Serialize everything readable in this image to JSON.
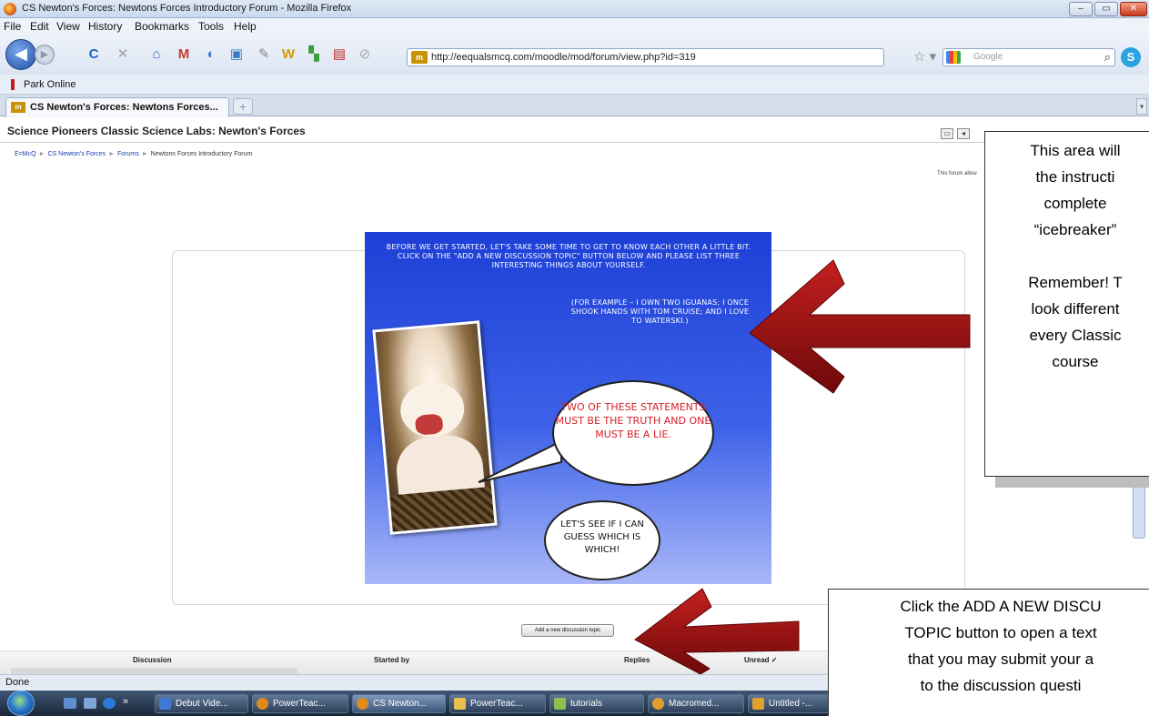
{
  "window": {
    "title": "CS Newton's Forces: Newtons Forces Introductory Forum - Mozilla Firefox",
    "min": "–",
    "max": "▭",
    "close": "✕"
  },
  "menu": [
    "File",
    "Edit",
    "View",
    "History",
    "Bookmarks",
    "Tools",
    "Help"
  ],
  "nav": {
    "url": "http://eequalsmcq.com/moodle/mod/forum/view.php?id=319",
    "search_placeholder": "Google",
    "favicon_text": "m"
  },
  "bookmarks": [
    "Park Online"
  ],
  "tabs": [
    {
      "label": "CS Newton's Forces: Newtons Forces..."
    }
  ],
  "page": {
    "site_title": "Science Pioneers Classic Science Labs: Newton's Forces",
    "breadcrumb": [
      "E=McQ",
      "CS Newton's Forces",
      "Forums",
      "Newtons Forces Introductory Forum"
    ],
    "forum_note": "This forum allow",
    "poster": {
      "intro": "BEFORE WE GET STARTED, LET'S TAKE SOME TIME TO GET TO KNOW EACH OTHER A LITTLE BIT. CLICK ON THE \"ADD A NEW DISCUSSION TOPIC\" BUTTON BELOW AND PLEASE LIST THREE INTERESTING THINGS ABOUT YOURSELF.",
      "example": "(FOR EXAMPLE – I OWN TWO IGUANAS; I ONCE SHOOK HANDS WITH TOM CRUISE; AND I LOVE TO WATERSKI.)",
      "bubble1": "TWO OF THESE STATEMENTS MUST BE THE TRUTH AND ONE MUST BE A LIE.",
      "bubble2": "LET'S SEE IF I CAN GUESS WHICH IS WHICH!"
    },
    "add_button": "Add a new discussion topic",
    "table_headers": [
      "Discussion",
      "Started by",
      "Replies",
      "Unread ✓"
    ]
  },
  "status": "Done",
  "taskbar": {
    "tasks": [
      "Debut Vide...",
      "PowerTeac...",
      "CS Newton...",
      "PowerTeac...",
      "tutorials",
      "Macromed...",
      "Untitled -..."
    ]
  },
  "callouts": {
    "top_lines": [
      "This area will",
      "the instructi",
      "complete",
      "“icebreaker”",
      "",
      "Remember!  T",
      "look different",
      "every Classic",
      "course"
    ],
    "bottom_lines": [
      "Click the ADD A NEW DISCU",
      "TOPIC button to open a text",
      "that you may submit your a",
      "to the discussion questi"
    ]
  },
  "colors": {
    "arrow": "#8b0d0d",
    "poster_blue": "#2a4ee0",
    "bubble_red": "#d8202a"
  }
}
